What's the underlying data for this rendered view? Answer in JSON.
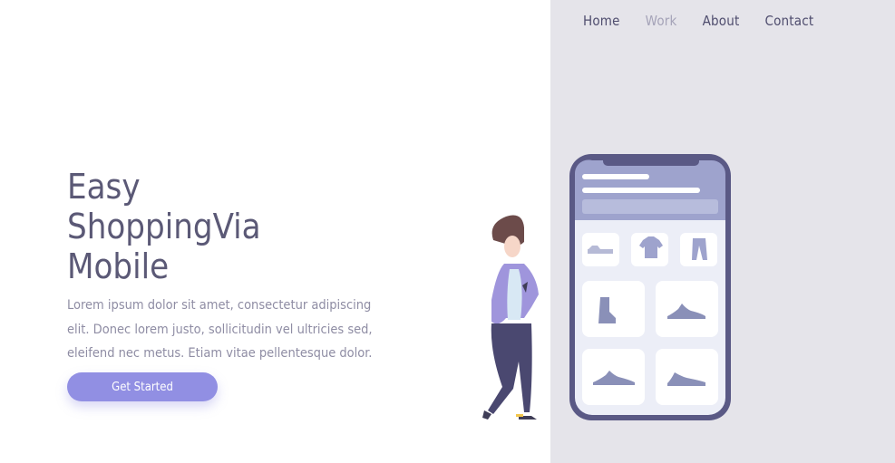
{
  "nav": {
    "items": [
      {
        "label": "Home"
      },
      {
        "label": "Work"
      },
      {
        "label": "About"
      },
      {
        "label": "Contact"
      }
    ],
    "active": "Work"
  },
  "hero": {
    "title_lines": [
      "Easy",
      "ShoppingVia",
      "Mobile"
    ],
    "paragraph": "Lorem ipsum dolor sit amet, consectetur adipiscing elit. Donec lorem justo, sollicitudin vel ultricies sed, eleifend nec metus. Etiam vitae pellentesque dolor.",
    "cta_label": "Get Started"
  },
  "colors": {
    "accent": "#918fe3",
    "heading": "#5b5976",
    "body_text": "#8f8da4",
    "panel_bg": "#e5e4ea",
    "phone_frame": "#5a5985",
    "product_icon": "#8a90b8"
  },
  "illustration": {
    "products": [
      "shoe-icon",
      "tshirt-icon",
      "pants-icon",
      "boot-icon",
      "sneaker-icon",
      "sneaker-icon",
      "sneaker-icon"
    ]
  }
}
